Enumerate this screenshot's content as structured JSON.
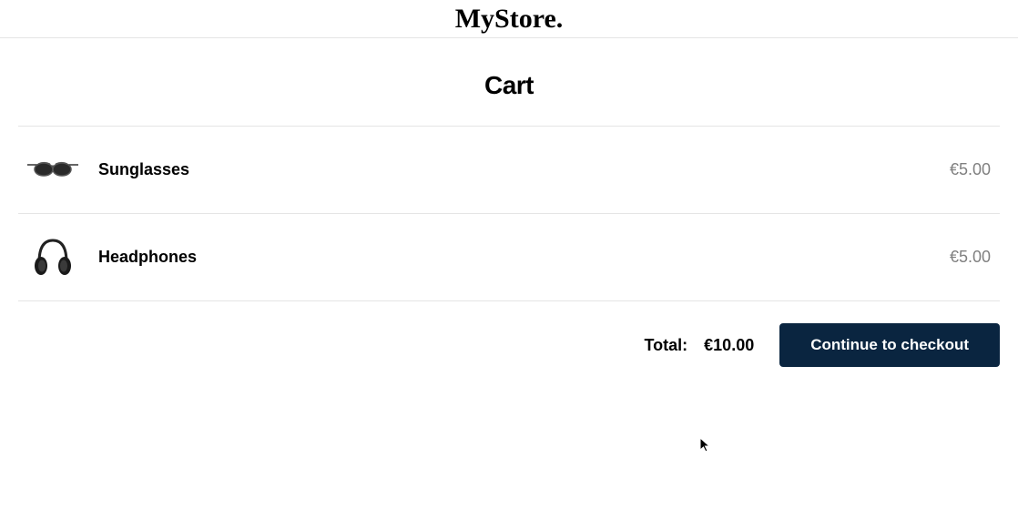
{
  "header": {
    "logo_text": "MyStore."
  },
  "page": {
    "title": "Cart"
  },
  "cart": {
    "items": [
      {
        "name": "Sunglasses",
        "price": "€5.00",
        "icon": "sunglasses"
      },
      {
        "name": "Headphones",
        "price": "€5.00",
        "icon": "headphones"
      }
    ],
    "total_label": "Total:",
    "total_value": "€10.00",
    "checkout_label": "Continue to checkout"
  },
  "colors": {
    "primary_button_bg": "#0a2540",
    "muted_text": "#808080",
    "border": "#e5e5e5"
  }
}
